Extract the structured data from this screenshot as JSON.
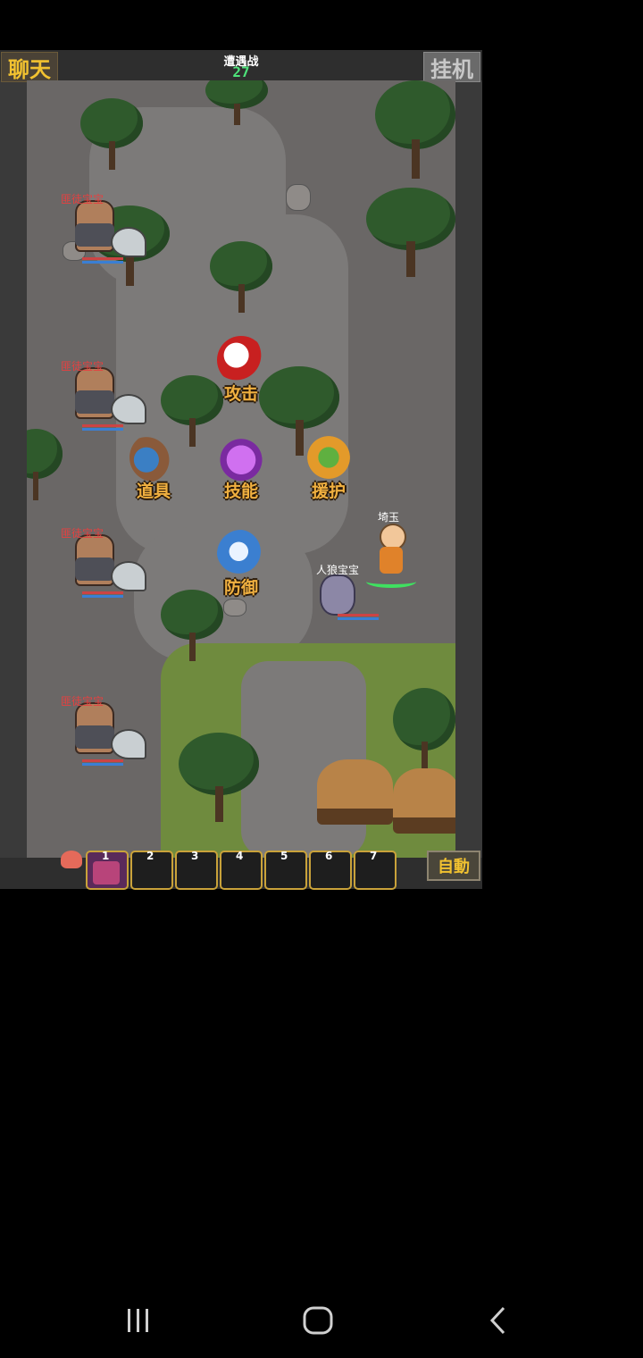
{
  "topbar": {
    "chat_label": "聊天",
    "idle_label": "挂机",
    "battle_title": "遭遇战",
    "turn_count": "27"
  },
  "enemies": [
    {
      "name": "匪徒宝宝"
    },
    {
      "name": "匪徒宝宝"
    },
    {
      "name": "匪徒宝宝"
    },
    {
      "name": "匪徒宝宝"
    }
  ],
  "battle_menu": {
    "attack": "攻击",
    "item": "道具",
    "skill": "技能",
    "assist": "援护",
    "defend": "防御"
  },
  "allies": {
    "hero_name": "埼玉",
    "pet_name": "人狼宝宝"
  },
  "slots": [
    "1",
    "2",
    "3",
    "4",
    "5",
    "6",
    "7"
  ],
  "auto_label": "自動",
  "colors": {
    "enemy_name": "#e64040",
    "menu_label": "#f0b040",
    "chat_text": "#f2c230",
    "turn_count": "#4de27a"
  },
  "nav": {
    "recent_icon": "recent-apps-icon",
    "home_icon": "home-icon",
    "back_icon": "back-icon"
  }
}
